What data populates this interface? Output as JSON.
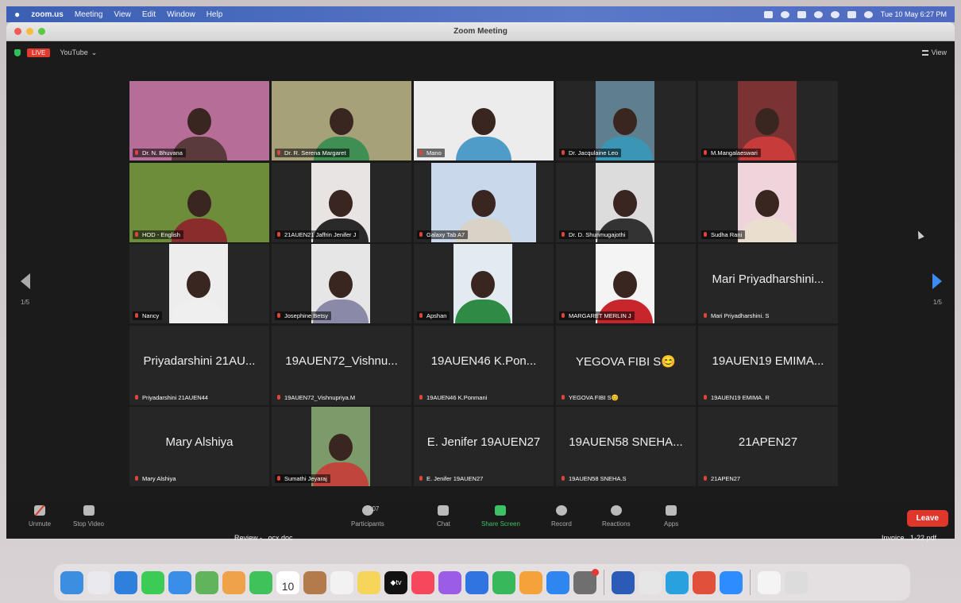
{
  "menubar": {
    "app": "zoom.us",
    "items": [
      "Meeting",
      "View",
      "Edit",
      "Window",
      "Help"
    ],
    "clock": "Tue 10 May 6:27 PM"
  },
  "window": {
    "title": "Zoom Meeting"
  },
  "topstrip": {
    "live": "LIVE",
    "stream_target": "YouTube",
    "stream_chevron": "⌄",
    "view_label": "View"
  },
  "pager": {
    "left": "1/5",
    "right": "1/5"
  },
  "participants": [
    {
      "label": "Dr. N. Bhuvana",
      "video": "#b66e98",
      "body": "#5a3a3a",
      "active": true
    },
    {
      "label": "Dr. R. Serena Margaret",
      "video": "#a7a17a",
      "body": "#3f8f55"
    },
    {
      "label": "Mano",
      "video": "#ececec",
      "body": "#4f9cc9"
    },
    {
      "label": "Dr. Jacqulaine Leo",
      "video": "#5f7f8e",
      "body": "#3b95b5"
    },
    {
      "label": "M.Mangalaeswari",
      "video": "#7a3232",
      "body": "#c73b3b"
    },
    {
      "label": "HOD - English",
      "video": "#6e8d3a",
      "body": "#8a2c2c"
    },
    {
      "label": "21AUEN21 Jaffrin Jenifer J",
      "video": "#e9e4e4",
      "body": "#2a2a2a"
    },
    {
      "label": "Galaxy Tab A7",
      "video": "#c9d8ea",
      "body": "#d9d2c6"
    },
    {
      "label": "Dr. D. Shunmugajothi",
      "video": "#dcdcdc",
      "body": "#333333"
    },
    {
      "label": "Sudha Rani",
      "video": "#f0d4dc",
      "body": "#eadfcf"
    },
    {
      "label": "Nancy",
      "video": "#ededed",
      "body": "#efefef"
    },
    {
      "label": "Josephine Betsy",
      "video": "#e6e6e6",
      "body": "#8a8aa8"
    },
    {
      "label": "Apshan",
      "video": "#e2ebf0",
      "body": "#2f8a45"
    },
    {
      "label": "MARGARET MERLIN J",
      "video": "#f4f4f4",
      "body": "#c7262c"
    },
    {
      "name": "Mari Priyadharshini...",
      "label": "Mari Priyadharshini. S"
    },
    {
      "name": "Priyadarshini 21AU...",
      "label": "Priyadarshini 21AUEN44"
    },
    {
      "name": "19AUEN72_Vishnu...",
      "label": "19AUEN72_Vishnupriya.M"
    },
    {
      "name": "19AUEN46 K.Pon...",
      "label": "19AUEN46 K.Ponmani"
    },
    {
      "name": "YEGOVA FIBI S😊",
      "label": "YEGOVA FIBI S😊"
    },
    {
      "name": "19AUEN19 EMIMA...",
      "label": "19AUEN19 EMIMA. R"
    },
    {
      "name": "Mary Alshiya",
      "label": "Mary Alshiya"
    },
    {
      "label": "Sumathi Jeyaraj",
      "video": "#7c9a6a",
      "body": "#c0453c"
    },
    {
      "name": "E. Jenifer 19AUEN27",
      "label": "E. Jenifer 19AUEN27"
    },
    {
      "name": "19AUEN58 SNEHA...",
      "label": "19AUEN58 SNEHA.S"
    },
    {
      "name": "21APEN27",
      "label": "21APEN27"
    }
  ],
  "toolbar": {
    "unmute": "Unmute",
    "stop_video": "Stop Video",
    "participants": "Participants",
    "participant_count": "107",
    "chat": "Chat",
    "share_screen": "Share Screen",
    "record": "Record",
    "reactions": "Reactions",
    "apps": "Apps",
    "leave": "Leave"
  },
  "desktop": {
    "file_left": "Review -...ocx.doc",
    "file_right": "Invoice...1-22.pdf"
  },
  "dock": {
    "calendar_day": "10",
    "tv_label": "◆tv",
    "icons": [
      "finder-icon",
      "launchpad-icon",
      "safari-icon",
      "messages-icon",
      "mail-icon",
      "maps-icon",
      "photos-icon",
      "facetime-icon",
      "calendar-icon",
      "contacts-icon",
      "reminders-icon",
      "notes-icon",
      "tv-icon",
      "music-icon",
      "podcasts-icon",
      "keynote-icon",
      "numbers-icon",
      "pages-icon",
      "app-store-icon",
      "system-preferences-icon",
      "word-icon",
      "chrome-icon",
      "telegram-icon",
      "office-icon",
      "zoom-icon",
      "document-icon",
      "trash-icon"
    ],
    "colors": [
      "#3c8fe0",
      "#e9e9ee",
      "#2f7fdd",
      "#3ccb55",
      "#3b8ee8",
      "#61b35c",
      "#f0a24a",
      "#3fc25a",
      "#ffffff",
      "#b37a4b",
      "#f2f2f2",
      "#f6d55a",
      "#111111",
      "#f5485c",
      "#9b5de5",
      "#2f74e0",
      "#37b85a",
      "#f4a33b",
      "#2f86f0",
      "#6f6f6f",
      "#2a5bb6",
      "#e6e6e6",
      "#2aa1df",
      "#e0503a",
      "#2d8cff",
      "#f4f4f4",
      "#dcdcdc"
    ]
  }
}
